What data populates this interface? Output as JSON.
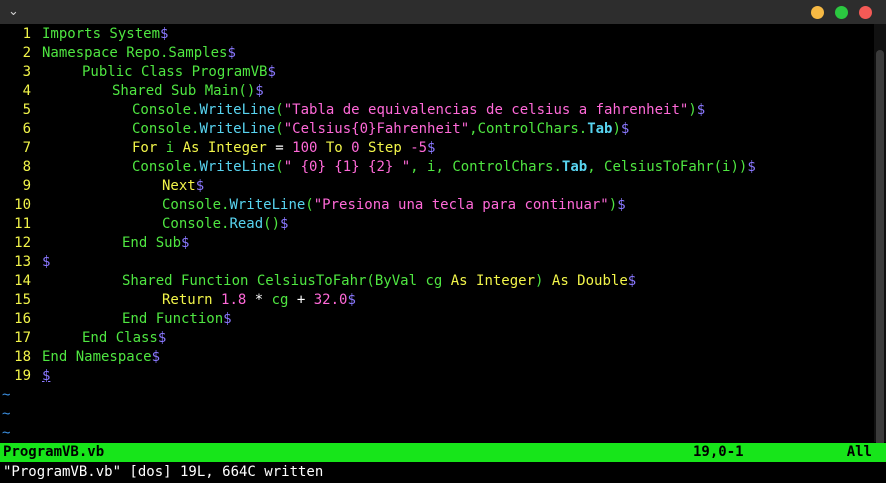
{
  "window": {
    "chevron": "⌄",
    "buttons": [
      "minimize",
      "maximize",
      "close"
    ]
  },
  "lines": [
    {
      "n": "1",
      "parts": [
        [
          "Imports System",
          "g"
        ],
        [
          "$",
          "eol"
        ]
      ]
    },
    {
      "n": "2",
      "parts": [
        [
          "Namespace Repo.Samples",
          "g"
        ],
        [
          "$",
          "eol"
        ]
      ]
    },
    {
      "n": "3",
      "indent": "ind1",
      "parts": [
        [
          "Public Class ProgramVB",
          "g"
        ],
        [
          "$",
          "eol"
        ]
      ]
    },
    {
      "n": "4",
      "indent": "ind2",
      "parts": [
        [
          "Shared Sub Main()",
          "g"
        ],
        [
          "$",
          "eol"
        ]
      ]
    },
    {
      "n": "5",
      "indent": "ind3",
      "parts": [
        [
          "Console.",
          "g"
        ],
        [
          "WriteLine",
          "cy"
        ],
        [
          "(",
          "g"
        ],
        [
          "\"Tabla de equivalencias de celsius a fahrenheit\"",
          "pink"
        ],
        [
          ")",
          "g"
        ],
        [
          "$",
          "eol"
        ]
      ]
    },
    {
      "n": "6",
      "indent": "ind3",
      "parts": [
        [
          "Console.",
          "g"
        ],
        [
          "WriteLine",
          "cy"
        ],
        [
          "(",
          "g"
        ],
        [
          "\"Celsius{0}Fahrenheit\"",
          "pink"
        ],
        [
          ",ControlChars.",
          "g"
        ],
        [
          "Tab",
          "cyb"
        ],
        [
          ")",
          "g"
        ],
        [
          "$",
          "eol"
        ]
      ]
    },
    {
      "n": "7",
      "indent": "ind3",
      "parts": [
        [
          "For ",
          "y"
        ],
        [
          "i ",
          "g"
        ],
        [
          "As Integer ",
          "y"
        ],
        [
          "= ",
          "w"
        ],
        [
          "100 ",
          "pink"
        ],
        [
          "To ",
          "y"
        ],
        [
          "0 ",
          "pink"
        ],
        [
          "Step ",
          "y"
        ],
        [
          "-5",
          "pink"
        ],
        [
          "$",
          "eol"
        ]
      ]
    },
    {
      "n": "8",
      "indent": "ind3",
      "parts": [
        [
          "Console.",
          "g"
        ],
        [
          "WriteLine",
          "cy"
        ],
        [
          "(",
          "g"
        ],
        [
          "\" {0} {1} {2} \"",
          "pink"
        ],
        [
          ", i, ControlChars.",
          "g"
        ],
        [
          "Tab",
          "cyb"
        ],
        [
          ", CelsiusToFahr(i))",
          "g"
        ],
        [
          "$",
          "eol"
        ]
      ]
    },
    {
      "n": "9",
      "indent": "ind4",
      "parts": [
        [
          "Next",
          "y"
        ],
        [
          "$",
          "eol"
        ]
      ]
    },
    {
      "n": "10",
      "indent": "ind4",
      "parts": [
        [
          "Console.",
          "g"
        ],
        [
          "WriteLine",
          "cy"
        ],
        [
          "(",
          "g"
        ],
        [
          "\"Presiona una tecla para continuar\"",
          "pink"
        ],
        [
          ")",
          "g"
        ],
        [
          "$",
          "eol"
        ]
      ]
    },
    {
      "n": "11",
      "indent": "ind4",
      "parts": [
        [
          "Console.",
          "g"
        ],
        [
          "Read",
          "cy"
        ],
        [
          "()",
          "g"
        ],
        [
          "$",
          "eol"
        ]
      ]
    },
    {
      "n": "12",
      "indent": "ind2b",
      "parts": [
        [
          "End Sub",
          "g"
        ],
        [
          "$",
          "eol"
        ]
      ]
    },
    {
      "n": "13",
      "parts": [
        [
          "$",
          "eol"
        ]
      ]
    },
    {
      "n": "14",
      "indent": "ind2b",
      "parts": [
        [
          "Shared Function CelsiusToFahr(ByVal ",
          "g"
        ],
        [
          "cg ",
          "g"
        ],
        [
          "As Integer",
          "y"
        ],
        [
          ") ",
          "g"
        ],
        [
          "As Double",
          "y"
        ],
        [
          "$",
          "eol"
        ]
      ]
    },
    {
      "n": "15",
      "indent": "ind4",
      "parts": [
        [
          "Return ",
          "y"
        ],
        [
          "1.8 ",
          "pink"
        ],
        [
          "* ",
          "w"
        ],
        [
          "cg ",
          "g"
        ],
        [
          "+ ",
          "w"
        ],
        [
          "32.0",
          "pink"
        ],
        [
          "$",
          "eol"
        ]
      ]
    },
    {
      "n": "16",
      "indent": "ind2b",
      "parts": [
        [
          "End Function",
          "g"
        ],
        [
          "$",
          "eol"
        ]
      ]
    },
    {
      "n": "17",
      "indent": "ind1",
      "parts": [
        [
          "End Class",
          "g"
        ],
        [
          "$",
          "eol"
        ]
      ]
    },
    {
      "n": "18",
      "parts": [
        [
          "End Namespace",
          "g"
        ],
        [
          "$",
          "eol"
        ]
      ]
    },
    {
      "n": "19",
      "parts": [
        [
          "$",
          "eolu"
        ]
      ]
    }
  ],
  "tildes": [
    "~",
    "~",
    "~"
  ],
  "status": {
    "filename": "ProgramVB.vb",
    "position": "19,0-1",
    "scroll": "All"
  },
  "cmdline": "\"ProgramVB.vb\" [dos] 19L, 664C written",
  "colors": {
    "status_bg": "#17e51a",
    "keyword": "#f2f54a",
    "identifier": "#4fe641",
    "string": "#ff69d8",
    "method": "#58d4f0",
    "eol": "#8a78ff"
  }
}
